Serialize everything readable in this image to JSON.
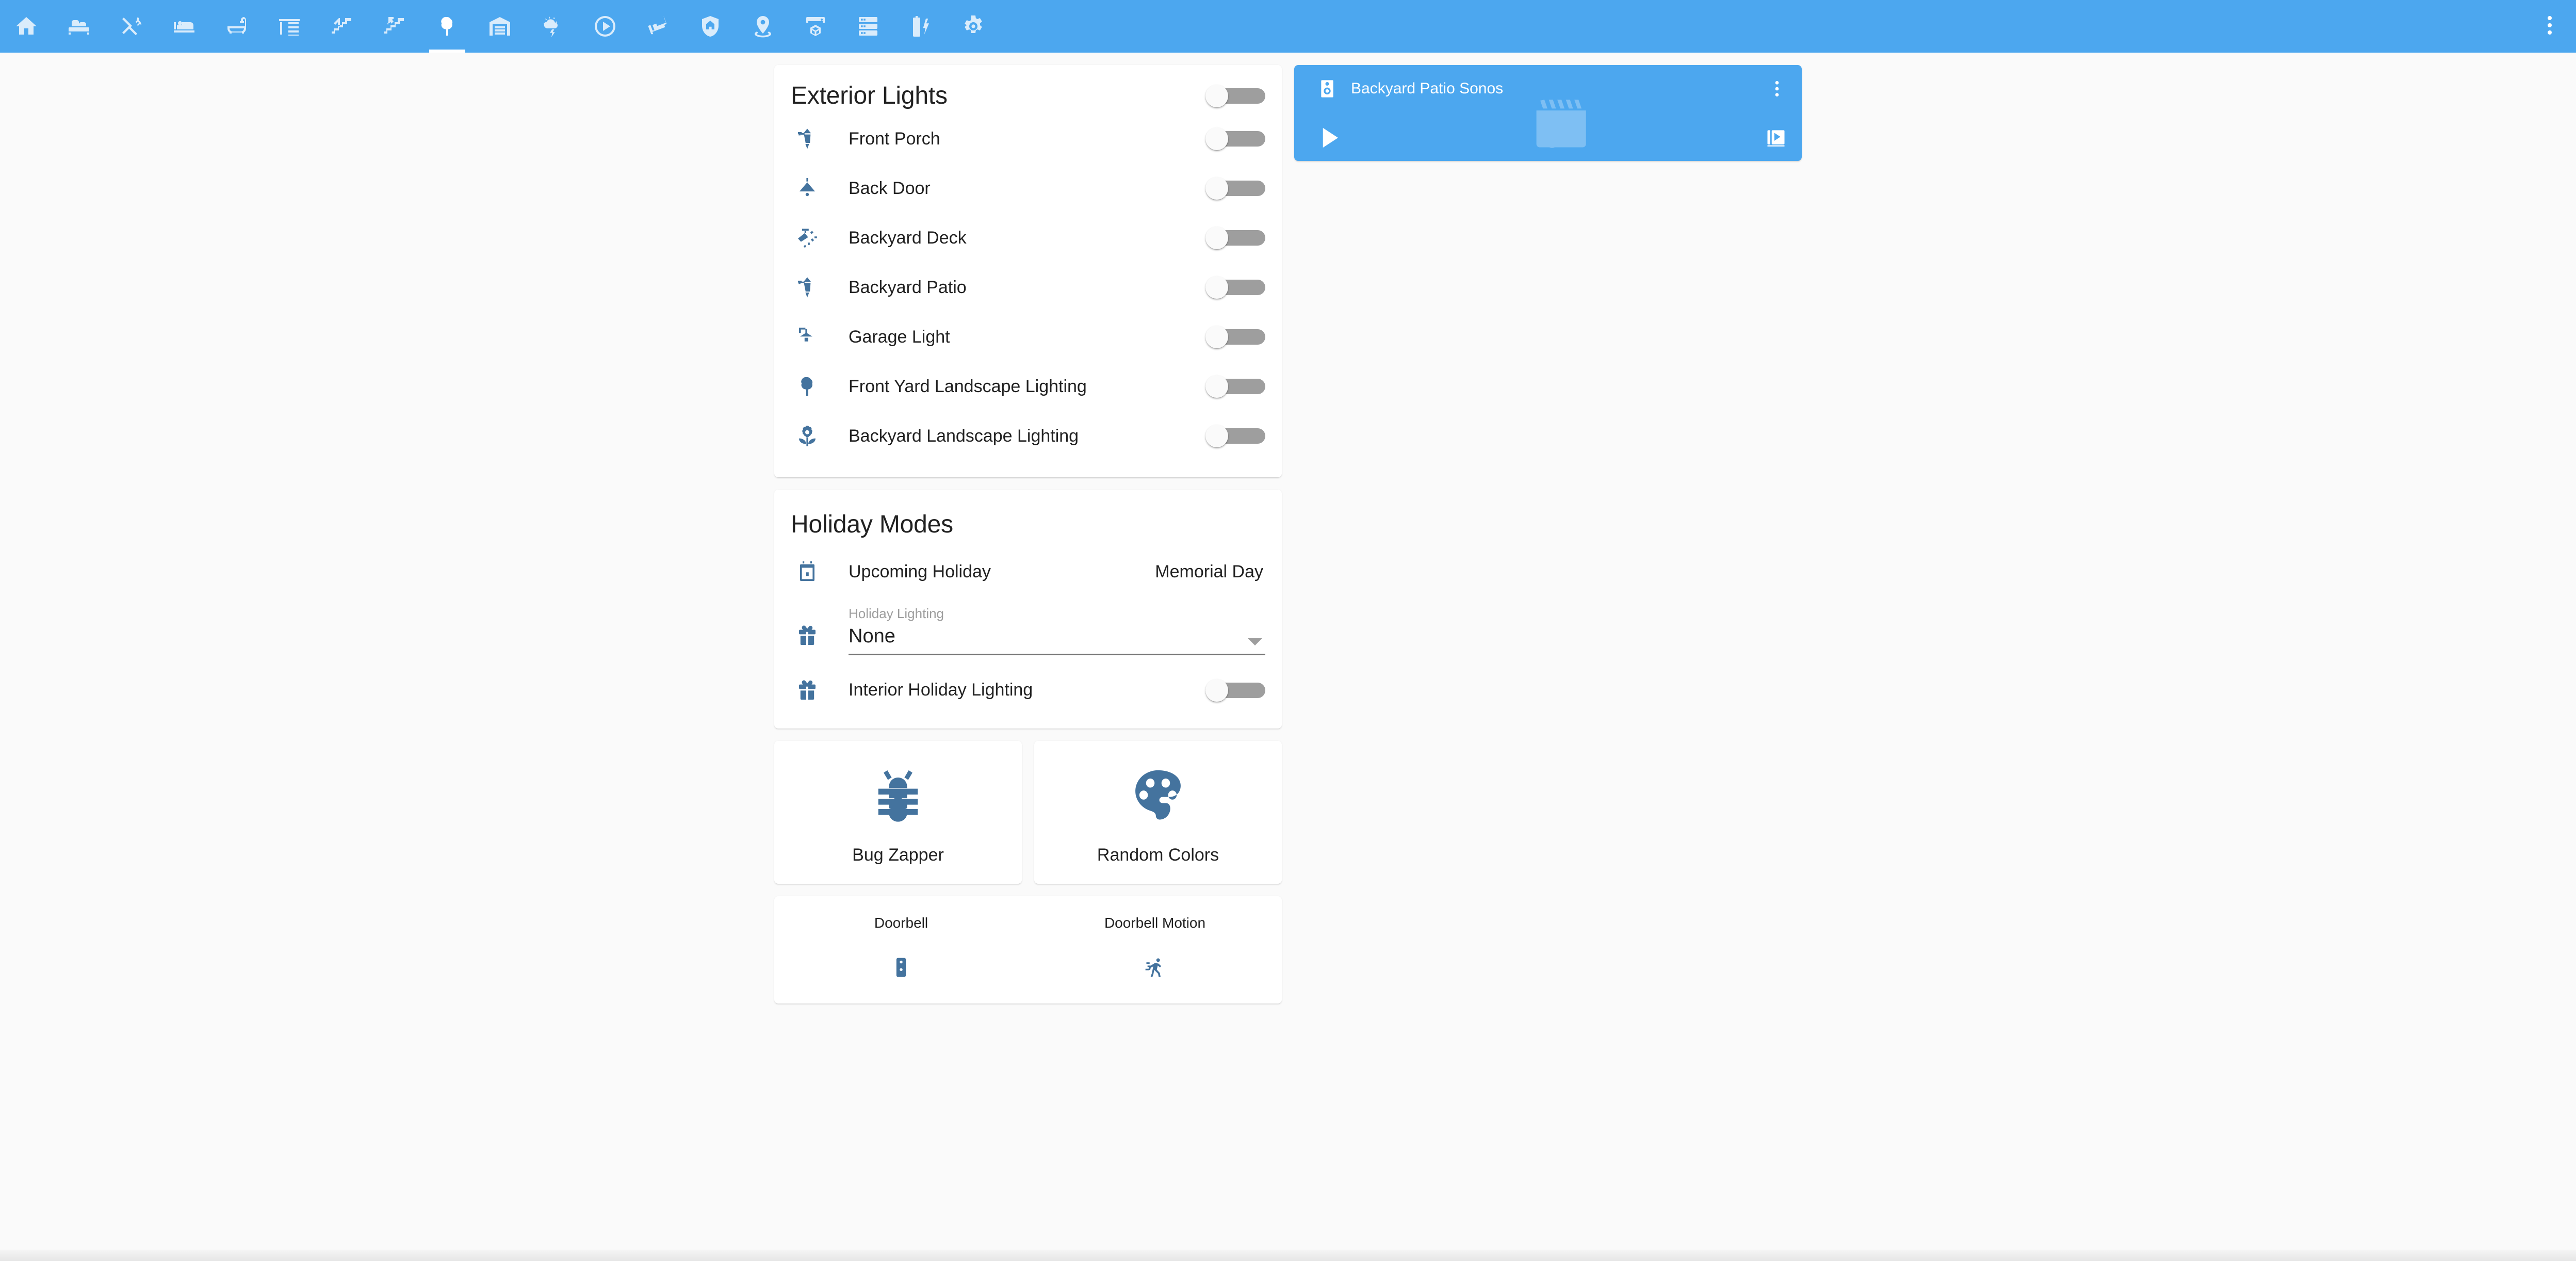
{
  "theme": {
    "primary": "#4ca7ef",
    "accent_icon": "#44739e",
    "background": "#fafafa",
    "card": "#ffffff",
    "toggle_off_track": "#9e9e9e",
    "text_primary": "#212121",
    "text_secondary": "#9e9e9e"
  },
  "appbar": {
    "overflow_icon": "dots-vertical-icon",
    "tabs": [
      {
        "icon": "home-icon",
        "active": false
      },
      {
        "icon": "sofa-icon",
        "active": false
      },
      {
        "icon": "fork-knife-icon",
        "active": false
      },
      {
        "icon": "bed-icon",
        "active": false
      },
      {
        "icon": "bathtub-icon",
        "active": false
      },
      {
        "icon": "desk-icon",
        "active": false
      },
      {
        "icon": "stairs-down-icon",
        "active": false
      },
      {
        "icon": "stairs-up-icon",
        "active": false
      },
      {
        "icon": "tree-icon",
        "active": true
      },
      {
        "icon": "garage-icon",
        "active": false
      },
      {
        "icon": "weather-lightning-icon",
        "active": false
      },
      {
        "icon": "play-circle-icon",
        "active": false
      },
      {
        "icon": "cctv-icon",
        "active": false
      },
      {
        "icon": "shield-home-icon",
        "active": false
      },
      {
        "icon": "map-marker-icon",
        "active": false
      },
      {
        "icon": "printer-3d-icon",
        "active": false
      },
      {
        "icon": "server-icon",
        "active": false
      },
      {
        "icon": "battery-charging-icon",
        "active": false
      },
      {
        "icon": "cog-icon",
        "active": false
      }
    ]
  },
  "exterior_lights_card": {
    "title": "Exterior Lights",
    "header_toggle": {
      "state": "off"
    },
    "rows": [
      {
        "icon": "outdoor-lamp-icon",
        "name": "Front Porch",
        "toggle": "off"
      },
      {
        "icon": "ceiling-light-icon",
        "name": "Back Door",
        "toggle": "off"
      },
      {
        "icon": "spotlight-beam-icon",
        "name": "Backyard Deck",
        "toggle": "off"
      },
      {
        "icon": "outdoor-lamp-icon",
        "name": "Backyard Patio",
        "toggle": "off"
      },
      {
        "icon": "wall-sconce-icon",
        "name": "Garage Light",
        "toggle": "off"
      },
      {
        "icon": "tree-icon",
        "name": "Front Yard Landscape Lighting",
        "toggle": "off"
      },
      {
        "icon": "flower-icon",
        "name": "Backyard Landscape Lighting",
        "toggle": "off"
      }
    ]
  },
  "holiday_modes_card": {
    "title": "Holiday Modes",
    "upcoming_holiday": {
      "icon": "calendar-icon",
      "name": "Upcoming Holiday",
      "value": "Memorial Day"
    },
    "holiday_lighting_select": {
      "icon": "gift-icon",
      "label": "Holiday Lighting",
      "value": "None",
      "arrow_icon": "chevron-down-icon",
      "options": [
        "None"
      ]
    },
    "interior_holiday_lighting": {
      "icon": "gift-icon",
      "name": "Interior Holiday Lighting",
      "toggle": "off"
    }
  },
  "button_cards": [
    {
      "icon": "bug-icon",
      "label": "Bug Zapper"
    },
    {
      "icon": "palette-icon",
      "label": "Random Colors"
    }
  ],
  "glance_card": {
    "items": [
      {
        "name": "Doorbell",
        "icon": "doorbell-icon"
      },
      {
        "name": "Doorbell Motion",
        "icon": "run-motion-icon"
      }
    ]
  },
  "media_player_card": {
    "icon": "speaker-icon",
    "title": "Backyard Patio Sonos",
    "menu_icon": "dots-vertical-icon",
    "artwork_placeholder_icon": "movie-music-icon",
    "play_icon": "play-icon",
    "browse_icon": "browse-media-icon"
  }
}
